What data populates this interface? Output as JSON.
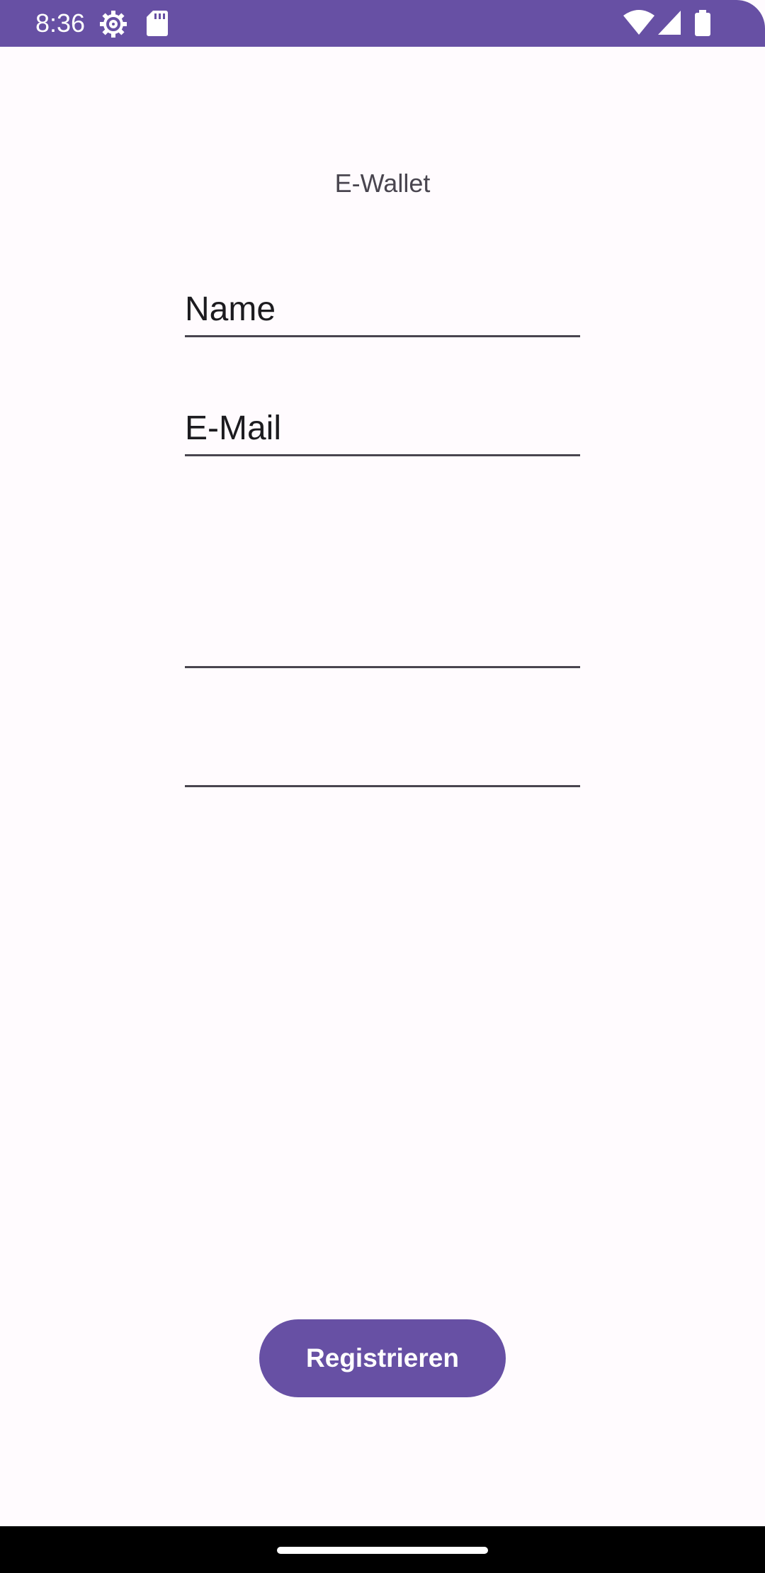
{
  "status_bar": {
    "time": "8:36",
    "icons_left": [
      "settings-gear-icon",
      "sd-card-icon"
    ],
    "icons_right": [
      "wifi-icon",
      "cell-signal-icon",
      "battery-icon"
    ]
  },
  "app": {
    "title": "E-Wallet"
  },
  "form": {
    "name_placeholder": "Name",
    "email_placeholder": "E-Mail",
    "field3_placeholder": "",
    "field4_placeholder": ""
  },
  "actions": {
    "register_label": "Registrieren"
  },
  "colors": {
    "primary": "#6750a4",
    "background": "#fffbfe",
    "on_surface": "#1c1b1f",
    "on_surface_variant": "#49454f"
  }
}
